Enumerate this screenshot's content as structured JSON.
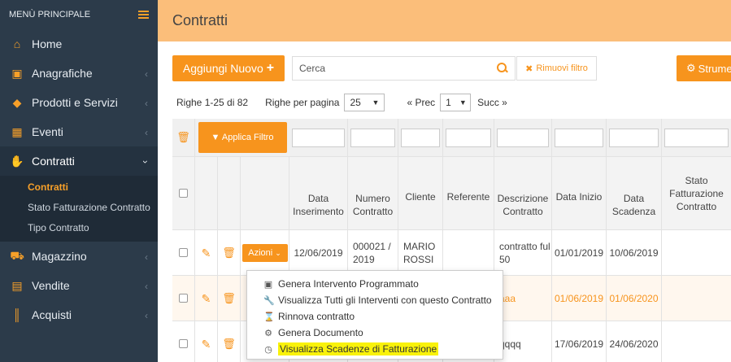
{
  "sidebar": {
    "title": "MENÙ PRINCIPALE",
    "items": [
      {
        "label": "Home",
        "icon": "home-icon"
      },
      {
        "label": "Anagrafiche",
        "icon": "address-card-icon"
      },
      {
        "label": "Prodotti e Servizi",
        "icon": "tag-icon"
      },
      {
        "label": "Eventi",
        "icon": "calendar-check-icon"
      },
      {
        "label": "Contratti",
        "icon": "handshake-icon"
      },
      {
        "label": "Magazzino",
        "icon": "truck-icon"
      },
      {
        "label": "Vendite",
        "icon": "shopping-basket-icon"
      },
      {
        "label": "Acquisti",
        "icon": "barcode-icon"
      }
    ],
    "subitems": [
      "Contratti",
      "Stato Fatturazione Contratto",
      "Tipo Contratto"
    ]
  },
  "page": {
    "title": "Contratti",
    "add_button": "Aggiungi Nuovo",
    "search_value": "Cerca",
    "remove_filter": "Rimuovi filtro",
    "tools_button": "Strume"
  },
  "pager": {
    "rows_info": "Righe 1-25 di 82",
    "per_page_label": "Righe per pagina",
    "per_page_value": "25",
    "prev": "« Prec",
    "page_value": "1",
    "next": "Succ »"
  },
  "table": {
    "filter_button": "Applica Filtro",
    "headers": [
      "Data Inserimento",
      "Numero Contratto",
      "Cliente",
      "Referente",
      "Descrizione Contratto",
      "Data Inizio",
      "Data Scadenza",
      "Stato Fatturazione Contratto"
    ],
    "actions_button": "Azioni",
    "rows": [
      {
        "data_ins": "12/06/2019",
        "numero": "000021 / 2019",
        "cliente": "MARIO ROSSI",
        "referente": "",
        "descrizione": "contratto ful 50",
        "inizio": "01/01/2019",
        "scadenza": "10/06/2019",
        "stato": ""
      },
      {
        "data_ins": "",
        "numero": "",
        "cliente": "",
        "referente": "",
        "descrizione": "aaa",
        "inizio": "01/06/2019",
        "scadenza": "01/06/2020",
        "stato": ""
      },
      {
        "data_ins": "",
        "numero": "",
        "cliente": "",
        "referente": "",
        "descrizione": "qqqq",
        "inizio": "17/06/2019",
        "scadenza": "24/06/2020",
        "stato": ""
      }
    ]
  },
  "dropdown": {
    "items": [
      {
        "label": "Genera Intervento Programmato",
        "icon": "calendar-plus-icon"
      },
      {
        "label": "Visualizza Tutti gli Interventi con questo Contratto",
        "icon": "wrench-icon"
      },
      {
        "label": "Rinnova contratto",
        "icon": "hourglass-icon"
      },
      {
        "label": "Genera Documento",
        "icon": "cogs-icon"
      },
      {
        "label": "Visualizza Scadenze di Fatturazione",
        "icon": "clock-icon"
      }
    ]
  },
  "colors": {
    "accent": "#f7941d",
    "sidebar": "#2c3b4a",
    "titlebar": "#fbbe7a",
    "highlight": "#f9f20a"
  }
}
